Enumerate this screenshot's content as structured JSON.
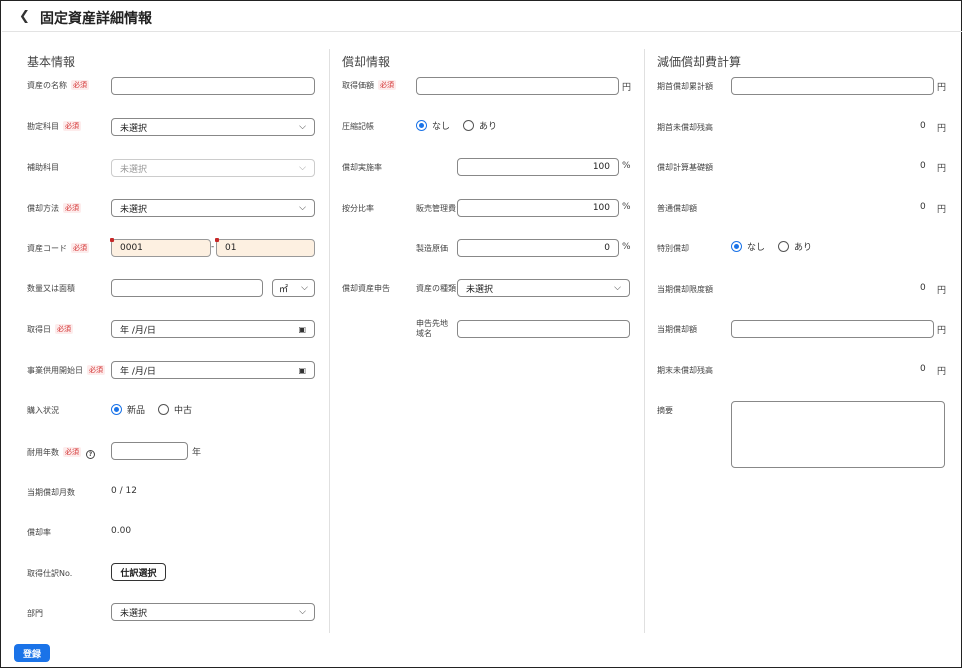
{
  "header": {
    "back_icon": "chevron-left-icon",
    "title": "固定資産詳細情報"
  },
  "basic": {
    "title": "基本情報",
    "required": "必須",
    "asset_name_label": "資産の名称",
    "account_label": "勘定科目",
    "account_value": "未選択",
    "sub_account_label": "補助科目",
    "sub_account_value": "未選択",
    "depr_method_label": "償却方法",
    "depr_method_value": "未選択",
    "asset_code_label": "資産コード",
    "asset_code_1": "0001",
    "asset_code_sep": "-",
    "asset_code_2": "01",
    "quantity_label": "数量又は面積",
    "quantity_unit": "㎡",
    "acquired_label": "取得日",
    "acquired_value": "年 /月/日",
    "in_service_label": "事業供用開始日",
    "in_service_value": "年 /月/日",
    "purchase_label": "購入状況",
    "purchase_new": "新品",
    "purchase_used": "中古",
    "useful_life_label": "耐用年数",
    "useful_life_unit": "年",
    "months_label": "当期償却月数",
    "months_value": "0 / 12",
    "rate_label": "償却率",
    "rate_value": "0.00",
    "journal_label": "取得仕訳No.",
    "journal_button": "仕訳選択",
    "dept_label": "部門",
    "dept_value": "未選択"
  },
  "depr": {
    "title": "償却情報",
    "cost_label": "取得価額",
    "cost_unit": "円",
    "compression_label": "圧縮記帳",
    "compression_none": "なし",
    "compression_yes": "あり",
    "impl_rate_label": "償却実施率",
    "impl_rate_value": "100",
    "alloc_label": "按分比率",
    "sga_label": "販売管理費",
    "sga_value": "100",
    "mfg_label": "製造原価",
    "mfg_value": "0",
    "pct": "%",
    "tax_report_label": "償却資産申告",
    "asset_kind_label": "資産の種類",
    "asset_kind_value": "未選択",
    "region_label": "申告先地域名"
  },
  "calc": {
    "title": "減価償却費計算",
    "opening_accum_label": "期首償却累計額",
    "yen": "円",
    "opening_unamort_label": "期首未償却残高",
    "opening_unamort_value": "0",
    "base_label": "償却計算基礎額",
    "base_value": "0",
    "normal_label": "普通償却額",
    "normal_value": "0",
    "special_label": "特別償却",
    "special_none": "なし",
    "special_yes": "あり",
    "limit_label": "当期償却限度額",
    "limit_value": "0",
    "current_label": "当期償却額",
    "closing_label": "期末未償却残高",
    "closing_value": "0",
    "memo_label": "摘要"
  },
  "footer": {
    "register_button": "登録"
  }
}
